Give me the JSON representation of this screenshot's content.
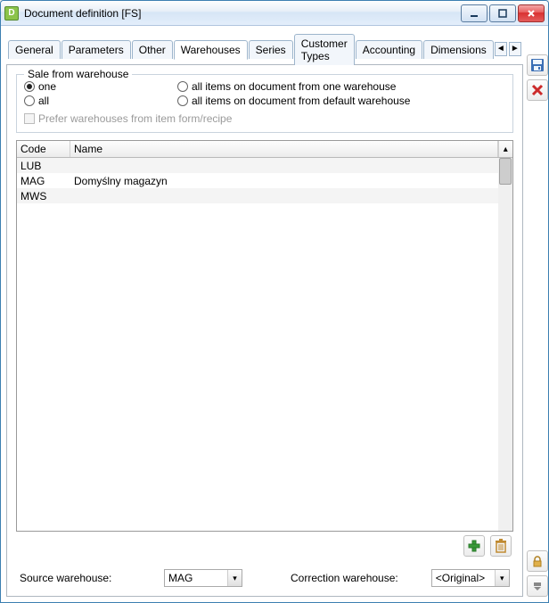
{
  "window": {
    "title": "Document definition [FS]"
  },
  "tabs": [
    {
      "label": "General"
    },
    {
      "label": "Parameters"
    },
    {
      "label": "Other"
    },
    {
      "label": "Warehouses"
    },
    {
      "label": "Series"
    },
    {
      "label": "Customer Types"
    },
    {
      "label": "Accounting"
    },
    {
      "label": "Dimensions"
    }
  ],
  "active_tab_index": 3,
  "groupbox_legend": "Sale from warehouse",
  "radios": {
    "one": "one",
    "all": "all",
    "all_from_one": "all items on document from one warehouse",
    "all_from_default": "all items on document from default warehouse"
  },
  "radio_selected": "one",
  "prefer_checkbox_label": "Prefer warehouses from item form/recipe",
  "grid": {
    "columns": {
      "code": "Code",
      "name": "Name"
    },
    "rows": [
      {
        "code": "LUB",
        "name": ""
      },
      {
        "code": "MAG",
        "name": "Domyślny magazyn"
      },
      {
        "code": "MWS",
        "name": ""
      }
    ]
  },
  "actions": {
    "add": "+",
    "delete": "🗑"
  },
  "form": {
    "source_label": "Source warehouse:",
    "source_value": "MAG",
    "correction_label": "Correction warehouse:",
    "correction_value": "<Original>"
  },
  "side": {
    "save": "💾",
    "close": "✖",
    "lock": "🔒",
    "dropdown": "▾"
  },
  "tab_nav": {
    "left": "◄",
    "right": "►"
  }
}
